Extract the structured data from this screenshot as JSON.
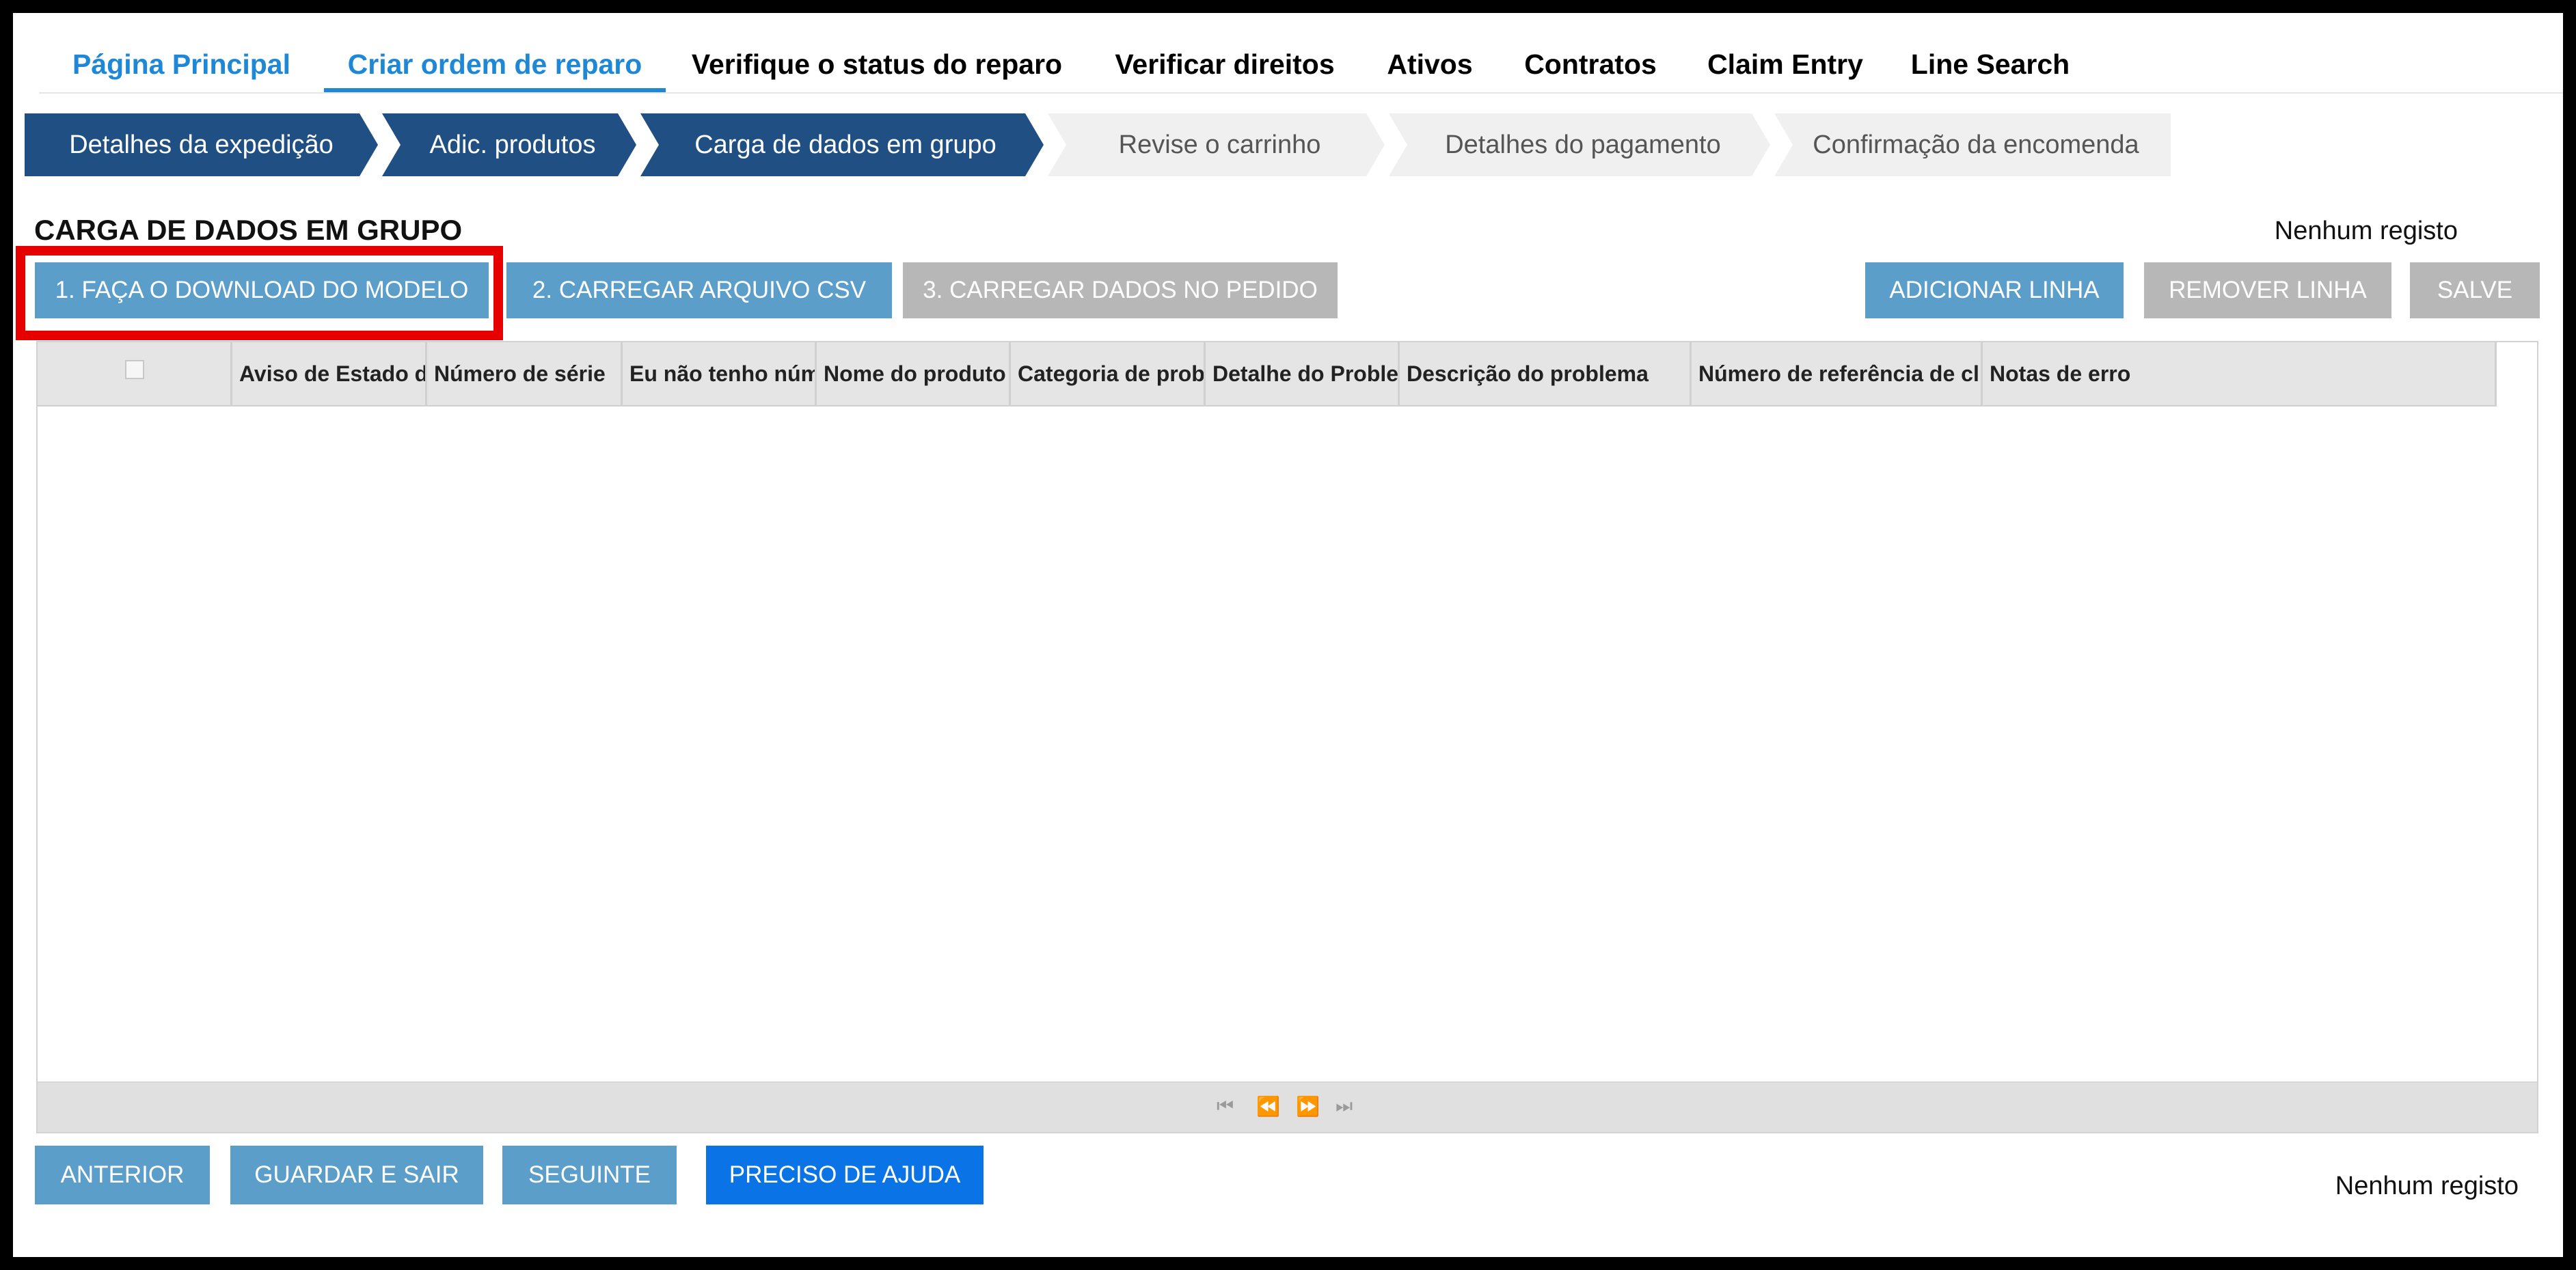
{
  "nav": {
    "tabs": [
      {
        "label": "Página Principal"
      },
      {
        "label": "Criar ordem de reparo"
      },
      {
        "label": "Verifique o status do reparo"
      },
      {
        "label": "Verificar direitos"
      },
      {
        "label": "Ativos"
      },
      {
        "label": "Contratos"
      },
      {
        "label": "Claim Entry"
      },
      {
        "label": "Line Search"
      }
    ],
    "active_tab": "Criar ordem de reparo"
  },
  "steps": [
    {
      "label": "Detalhes da expedição",
      "state": "completed"
    },
    {
      "label": "Adic. produtos",
      "state": "completed"
    },
    {
      "label": "Carga de dados em grupo",
      "state": "current"
    },
    {
      "label": "Revise o carrinho",
      "state": "pending"
    },
    {
      "label": "Detalhes do pagamento",
      "state": "pending"
    },
    {
      "label": "Confirmação da encomenda",
      "state": "pending"
    }
  ],
  "section": {
    "title": "CARGA DE DADOS EM GRUPO",
    "record_status": "Nenhum registo"
  },
  "actions": {
    "download_template": "1. FAÇA O DOWNLOAD DO MODELO",
    "upload_csv": "2. CARREGAR ARQUIVO CSV",
    "load_into_order": "3. CARREGAR DADOS NO PEDIDO",
    "add_row": "ADICIONAR LINHA",
    "remove_row": "REMOVER LINHA",
    "save": "SALVE"
  },
  "grid": {
    "columns": [
      "Aviso de Estado d",
      "Número de série",
      "Eu não tenho núm",
      "Nome do produto",
      "Categoria de probl",
      "Detalhe do Probler",
      "Descrição do problema",
      "Número de referência de clie",
      "Notas de erro"
    ],
    "rows": []
  },
  "footer": {
    "previous": "ANTERIOR",
    "save_exit": "GUARDAR E SAIR",
    "next": "SEGUINTE",
    "help": "PRECISO DE AJUDA",
    "record_status": "Nenhum registo"
  },
  "colors": {
    "nav_active": "#1e88d6",
    "step_completed": "#1f4f83",
    "step_pending": "#f0f0f0",
    "button_blue": "#5b9ec9",
    "button_disabled": "#b7b7b7",
    "button_primary": "#0a73e6",
    "highlight": "#e60000"
  }
}
